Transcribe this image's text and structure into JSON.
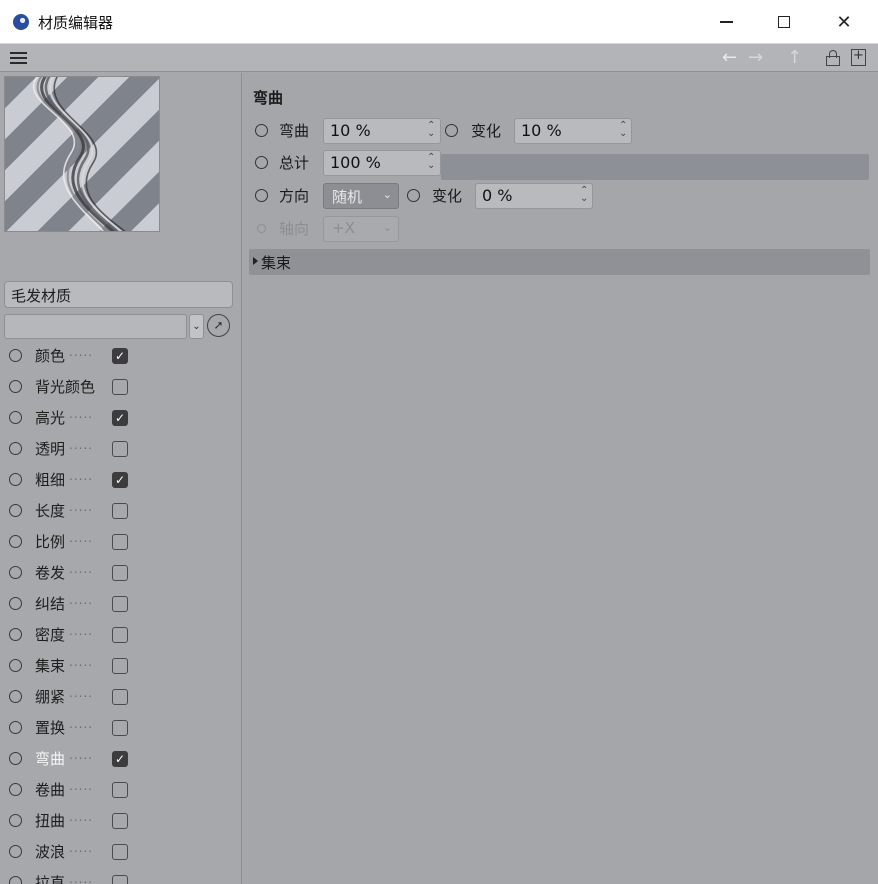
{
  "window": {
    "title": "材质编辑器"
  },
  "material": {
    "name": "毛发材质",
    "link_value": ""
  },
  "channels": [
    {
      "label": "颜色",
      "checked": true,
      "active": false
    },
    {
      "label": "背光颜色",
      "checked": false,
      "active": false
    },
    {
      "label": "高光",
      "checked": true,
      "active": false
    },
    {
      "label": "透明",
      "checked": false,
      "active": false
    },
    {
      "label": "粗细",
      "checked": true,
      "active": false
    },
    {
      "label": "长度",
      "checked": false,
      "active": false
    },
    {
      "label": "比例",
      "checked": false,
      "active": false
    },
    {
      "label": "卷发",
      "checked": false,
      "active": false
    },
    {
      "label": "纠结",
      "checked": false,
      "active": false
    },
    {
      "label": "密度",
      "checked": false,
      "active": false
    },
    {
      "label": "集束",
      "checked": false,
      "active": false
    },
    {
      "label": "绷紧",
      "checked": false,
      "active": false
    },
    {
      "label": "置换",
      "checked": false,
      "active": false
    },
    {
      "label": "弯曲",
      "checked": true,
      "active": true
    },
    {
      "label": "卷曲",
      "checked": false,
      "active": false
    },
    {
      "label": "扭曲",
      "checked": false,
      "active": false
    },
    {
      "label": "波浪",
      "checked": false,
      "active": false
    },
    {
      "label": "拉直",
      "checked": false,
      "active": false
    }
  ],
  "section": {
    "title": "弯曲",
    "bend": {
      "label": "弯曲",
      "value": "10 %"
    },
    "bend_variation": {
      "label": "变化",
      "value": "10 %"
    },
    "total": {
      "label": "总计",
      "value": "100 %",
      "fraction": 1.0
    },
    "direction": {
      "label": "方向",
      "value": "随机"
    },
    "direction_variation": {
      "label": "变化",
      "value": "0 %"
    },
    "axis": {
      "label": "轴向",
      "value": "+X"
    },
    "group": {
      "label": "集束"
    }
  },
  "icons": {
    "hamburger": "menu-icon",
    "back": "←",
    "forward": "→",
    "up": "↑",
    "close": "✕",
    "check": "✓",
    "spin": "⌃⌄",
    "chevron": "⌄"
  }
}
